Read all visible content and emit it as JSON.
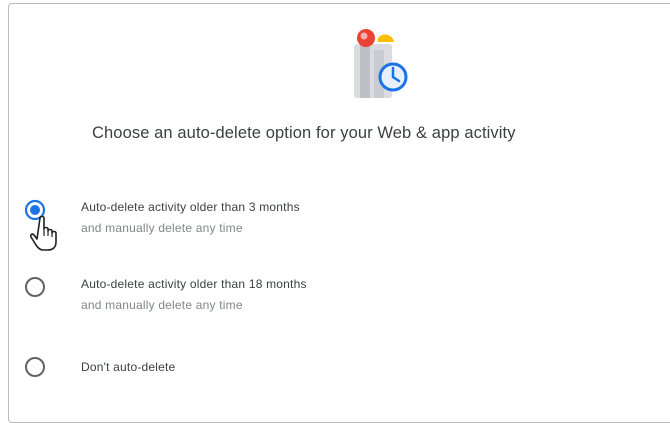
{
  "dialog": {
    "title": "Choose an auto-delete option for your Web & app activity"
  },
  "illustration": {
    "icon": "clock-activity-icon"
  },
  "options": [
    {
      "label": "Auto-delete activity older than 3 months",
      "sublabel": "and manually delete any time",
      "selected": true
    },
    {
      "label": "Auto-delete activity older than 18 months",
      "sublabel": "and manually delete any time",
      "selected": false
    },
    {
      "label": "Don't auto-delete",
      "selected": false
    }
  ],
  "colors": {
    "accent": "#1a73e8",
    "text": "#3c4043",
    "secondary_text": "#80868b",
    "radio_unselected": "#5f6368"
  },
  "cursor": {
    "icon": "hand-pointer-icon"
  }
}
